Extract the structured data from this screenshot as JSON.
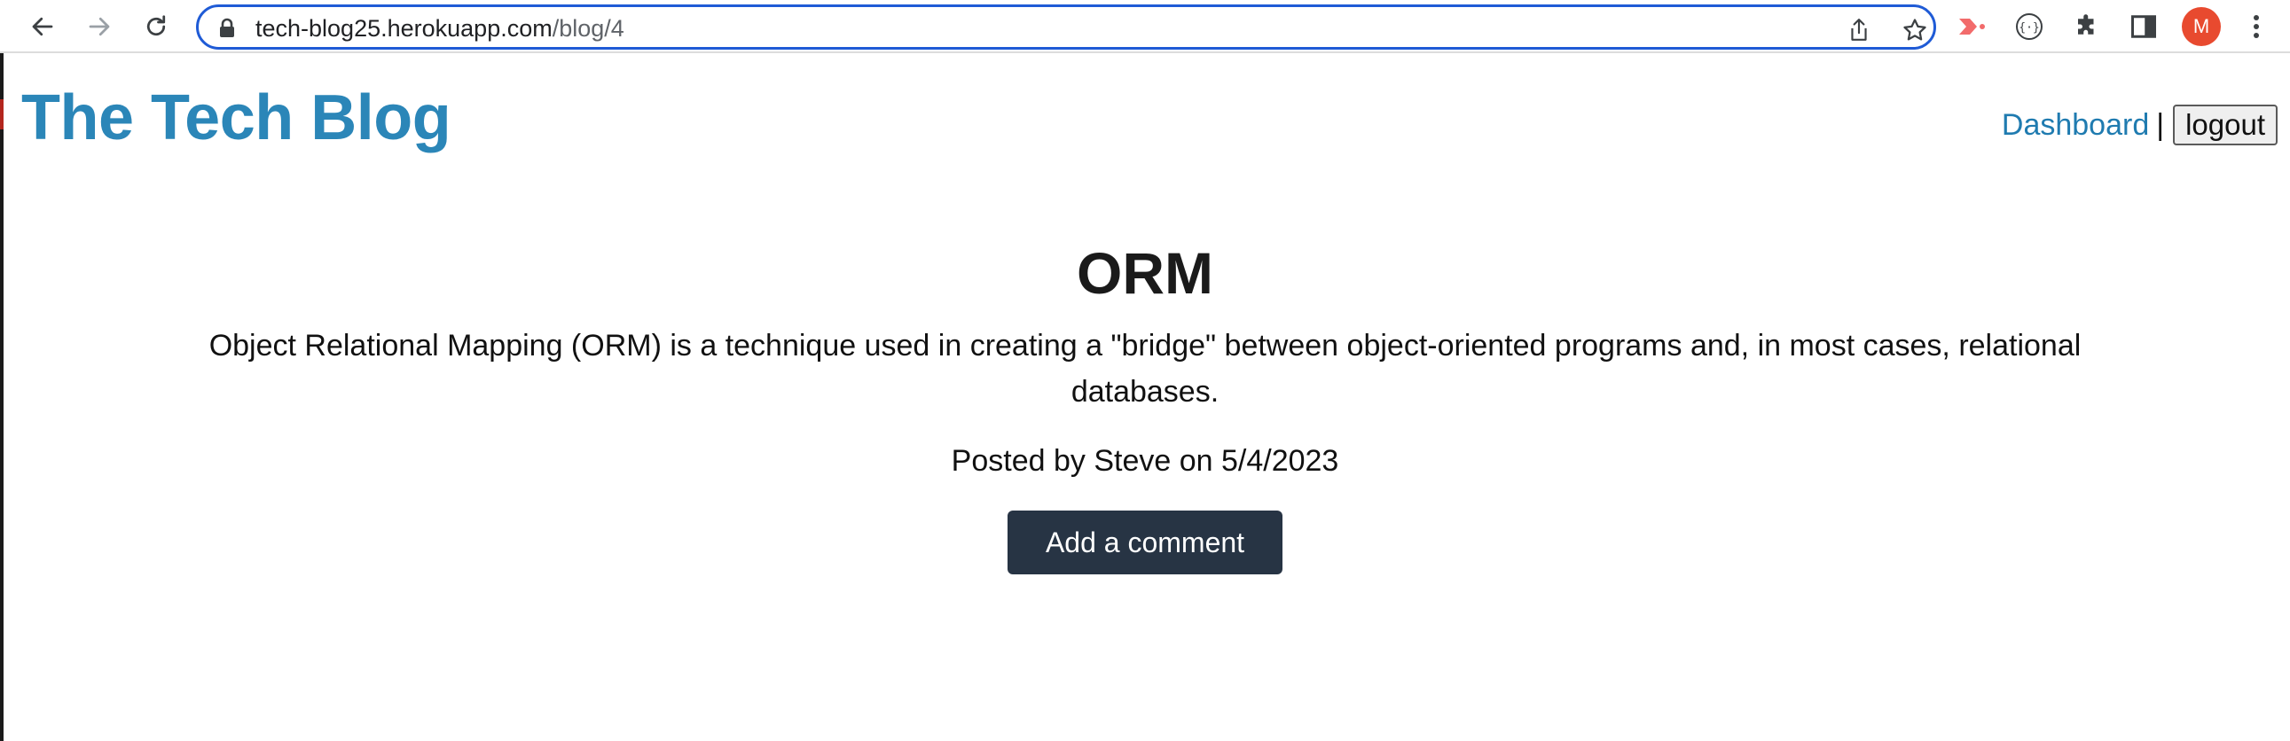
{
  "browser": {
    "url_host": "tech-blog25.herokuapp.com",
    "url_path": "/blog/4",
    "avatar_letter": "M"
  },
  "header": {
    "site_title": "The Tech Blog",
    "dashboard_link": "Dashboard",
    "separator": "|",
    "logout_label": "logout"
  },
  "post": {
    "title": "ORM",
    "body": "Object Relational Mapping (ORM) is a technique used in creating a \"bridge\" between object-oriented programs and, in most cases, relational databases.",
    "meta": "Posted by Steve on 5/4/2023",
    "add_comment_label": "Add a comment"
  },
  "colors": {
    "brand": "#2b86b8",
    "link": "#1f7bb0",
    "button_dark": "#273444",
    "omnibox_focus": "#1f5bd6",
    "avatar": "#e84a2f"
  }
}
